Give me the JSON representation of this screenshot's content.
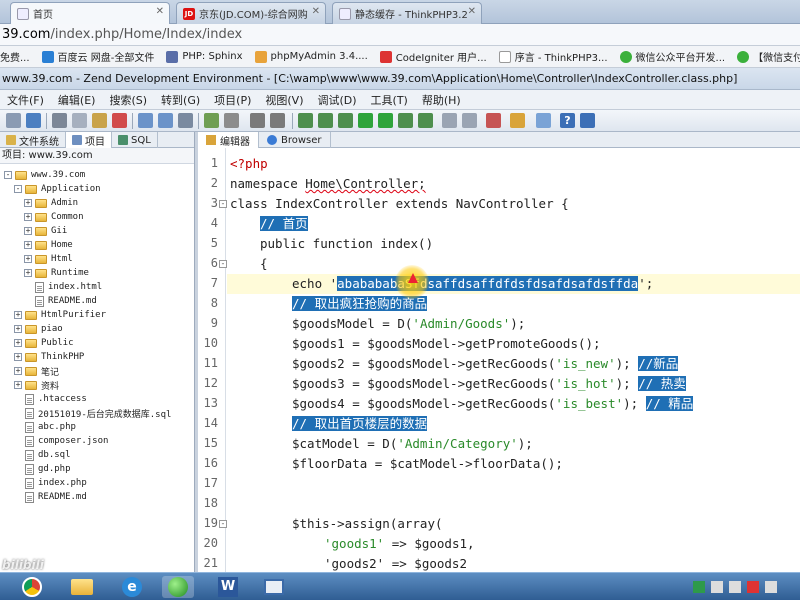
{
  "browser": {
    "tabs": [
      {
        "label": "首页",
        "icon": "document-icon"
      },
      {
        "label": "京东(JD.COM)-综合网购",
        "icon": "jd-icon"
      },
      {
        "label": "静态缓存 - ThinkPHP3.2",
        "icon": "document-icon"
      }
    ],
    "url_domain": "39.com",
    "url_path": "/index.php/Home/Index/index",
    "bookmarks": [
      {
        "label": "免费..."
      },
      {
        "label": "百度云 网盘-全部文件"
      },
      {
        "label": "PHP: Sphinx"
      },
      {
        "label": "phpMyAdmin 3.4...."
      },
      {
        "label": "CodeIgniter 用户..."
      },
      {
        "label": "序言 - ThinkPHP3..."
      },
      {
        "label": "微信公众平台开发..."
      },
      {
        "label": "【微信支付】普通..."
      }
    ]
  },
  "ide": {
    "title": "www.39.com - Zend Development Environment - [C:\\wamp\\www\\www.39.com\\Application\\Home\\Controller\\IndexController.class.php]",
    "menus": [
      "文件(F)",
      "编辑(E)",
      "搜索(S)",
      "转到(G)",
      "项目(P)",
      "视图(V)",
      "调试(D)",
      "工具(T)",
      "帮助(H)"
    ],
    "left_tabs": [
      "文件系统",
      "项目",
      "SQL"
    ],
    "project_label": "项目: www.39.com",
    "editor_tabs": [
      "编辑器",
      "Browser"
    ]
  },
  "tree": [
    {
      "label": "www.39.com",
      "kind": "folder",
      "expander": "-"
    },
    {
      "label": "Application",
      "kind": "folder",
      "expander": "-"
    },
    {
      "label": "Admin",
      "kind": "folder",
      "expander": "+"
    },
    {
      "label": "Common",
      "kind": "folder",
      "expander": "+"
    },
    {
      "label": "Gii",
      "kind": "folder",
      "expander": "+"
    },
    {
      "label": "Home",
      "kind": "folder",
      "expander": "+"
    },
    {
      "label": "Html",
      "kind": "folder",
      "expander": "+"
    },
    {
      "label": "Runtime",
      "kind": "folder",
      "expander": "+"
    },
    {
      "label": "index.html",
      "kind": "file",
      "expander": ""
    },
    {
      "label": "README.md",
      "kind": "file",
      "expander": ""
    },
    {
      "label": "HtmlPurifier",
      "kind": "folder",
      "expander": "+"
    },
    {
      "label": "piao",
      "kind": "folder",
      "expander": "+"
    },
    {
      "label": "Public",
      "kind": "folder",
      "expander": "+"
    },
    {
      "label": "ThinkPHP",
      "kind": "folder",
      "expander": "+"
    },
    {
      "label": "笔记",
      "kind": "folder",
      "expander": "+"
    },
    {
      "label": "资料",
      "kind": "folder",
      "expander": "+"
    },
    {
      "label": ".htaccess",
      "kind": "file",
      "expander": ""
    },
    {
      "label": "20151019-后台完成数据库.sql",
      "kind": "file",
      "expander": ""
    },
    {
      "label": "abc.php",
      "kind": "file",
      "expander": ""
    },
    {
      "label": "composer.json",
      "kind": "file",
      "expander": ""
    },
    {
      "label": "db.sql",
      "kind": "file",
      "expander": ""
    },
    {
      "label": "gd.php",
      "kind": "file",
      "expander": ""
    },
    {
      "label": "index.php",
      "kind": "file",
      "expander": ""
    },
    {
      "label": "README.md",
      "kind": "file",
      "expander": ""
    }
  ],
  "code": {
    "l1": "<?php",
    "l2_kw": "namespace ",
    "l2_ns": "Home\\Controller;",
    "l3": "class IndexController extends NavController {",
    "l4": "// 首页",
    "l5": "public function index()",
    "l6": "{",
    "l7_pre": "echo '",
    "l7_sel": "ababababaSfdsaffdsaffdfdsfdsafdsafdsffda",
    "l7_post": "';",
    "l8": "// 取出疯狂抢购的商品",
    "l9_a": "$goodsModel = D(",
    "l9_s": "'Admin/Goods'",
    "l9_b": ");",
    "l10": "$goods1 = $goodsModel->getPromoteGoods();",
    "l11_a": "$goods2 = $goodsModel->getRecGoods(",
    "l11_s": "'is_new'",
    "l11_b": "); ",
    "l11_c": "//新品",
    "l12_a": "$goods3 = $goodsModel->getRecGoods(",
    "l12_s": "'is_hot'",
    "l12_b": "); ",
    "l12_c": "// 热卖",
    "l13_a": "$goods4 = $goodsModel->getRecGoods(",
    "l13_s": "'is_best'",
    "l13_b": "); ",
    "l13_c": "// 精品",
    "l14": "// 取出首页楼层的数据",
    "l15_a": "$catModel = D(",
    "l15_s": "'Admin/Category'",
    "l15_b": ");",
    "l16": "$floorData = $catModel->floorData();",
    "l19": "$this->assign(array(",
    "l20_s": "'goods1'",
    "l20_b": " => $goods1,",
    "l21": "'goods2' => $goods2"
  },
  "line_numbers": [
    "1",
    "2",
    "3",
    "4",
    "5",
    "6",
    "7",
    "8",
    "9",
    "10",
    "11",
    "12",
    "13",
    "14",
    "15",
    "16",
    "17",
    "18",
    "19",
    "20",
    "21"
  ],
  "taskbar": {
    "apps": [
      "chrome-icon",
      "folder-icon",
      "ie-icon",
      "zend-icon",
      "word-icon",
      "window-icon"
    ],
    "watermark": "bilibili"
  },
  "colors": {
    "selection": "#1f6fb5",
    "string": "#2a8a2a",
    "keyword": "#1f2f8f"
  }
}
